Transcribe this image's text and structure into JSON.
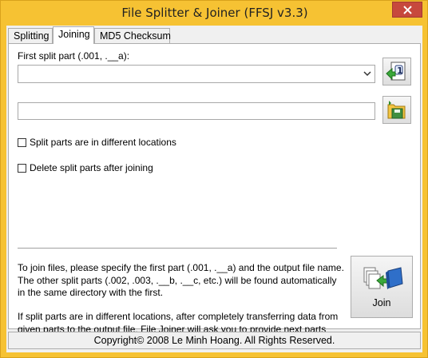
{
  "window": {
    "title": "File Splitter & Joiner (FFSJ v3.3)"
  },
  "tabs": [
    {
      "label": "Splitting"
    },
    {
      "label": "Joining"
    },
    {
      "label": "MD5 Checksum"
    }
  ],
  "joining": {
    "first_part_label": "First split part (.001, .__a):",
    "first_part_value": "",
    "output_value": "",
    "checkbox_different_locations": "Split parts are in different locations",
    "checkbox_delete_after": "Delete split parts after joining",
    "help_text_1": "To join files, please specify the first part (.001, .__a) and the output file name. The other split parts (.002, .003, .__b, .__c, etc.) will be found automatically in the same directory with the first.",
    "help_text_2": "If split parts are in different locations, after completely transferring data from given parts to the output file, File Joiner will ask you to provide next parts before continuing.",
    "join_button_label": "Join"
  },
  "status": {
    "copyright": "Copyright© 2008 Le Minh Hoang. All Rights Reserved."
  },
  "colors": {
    "frame": "#f6c233",
    "close_button": "#c7483d",
    "panel": "#ffffff"
  },
  "icons": [
    "close-icon",
    "chevron-down-icon",
    "open-first-part-icon",
    "save-output-icon",
    "join-files-icon"
  ]
}
